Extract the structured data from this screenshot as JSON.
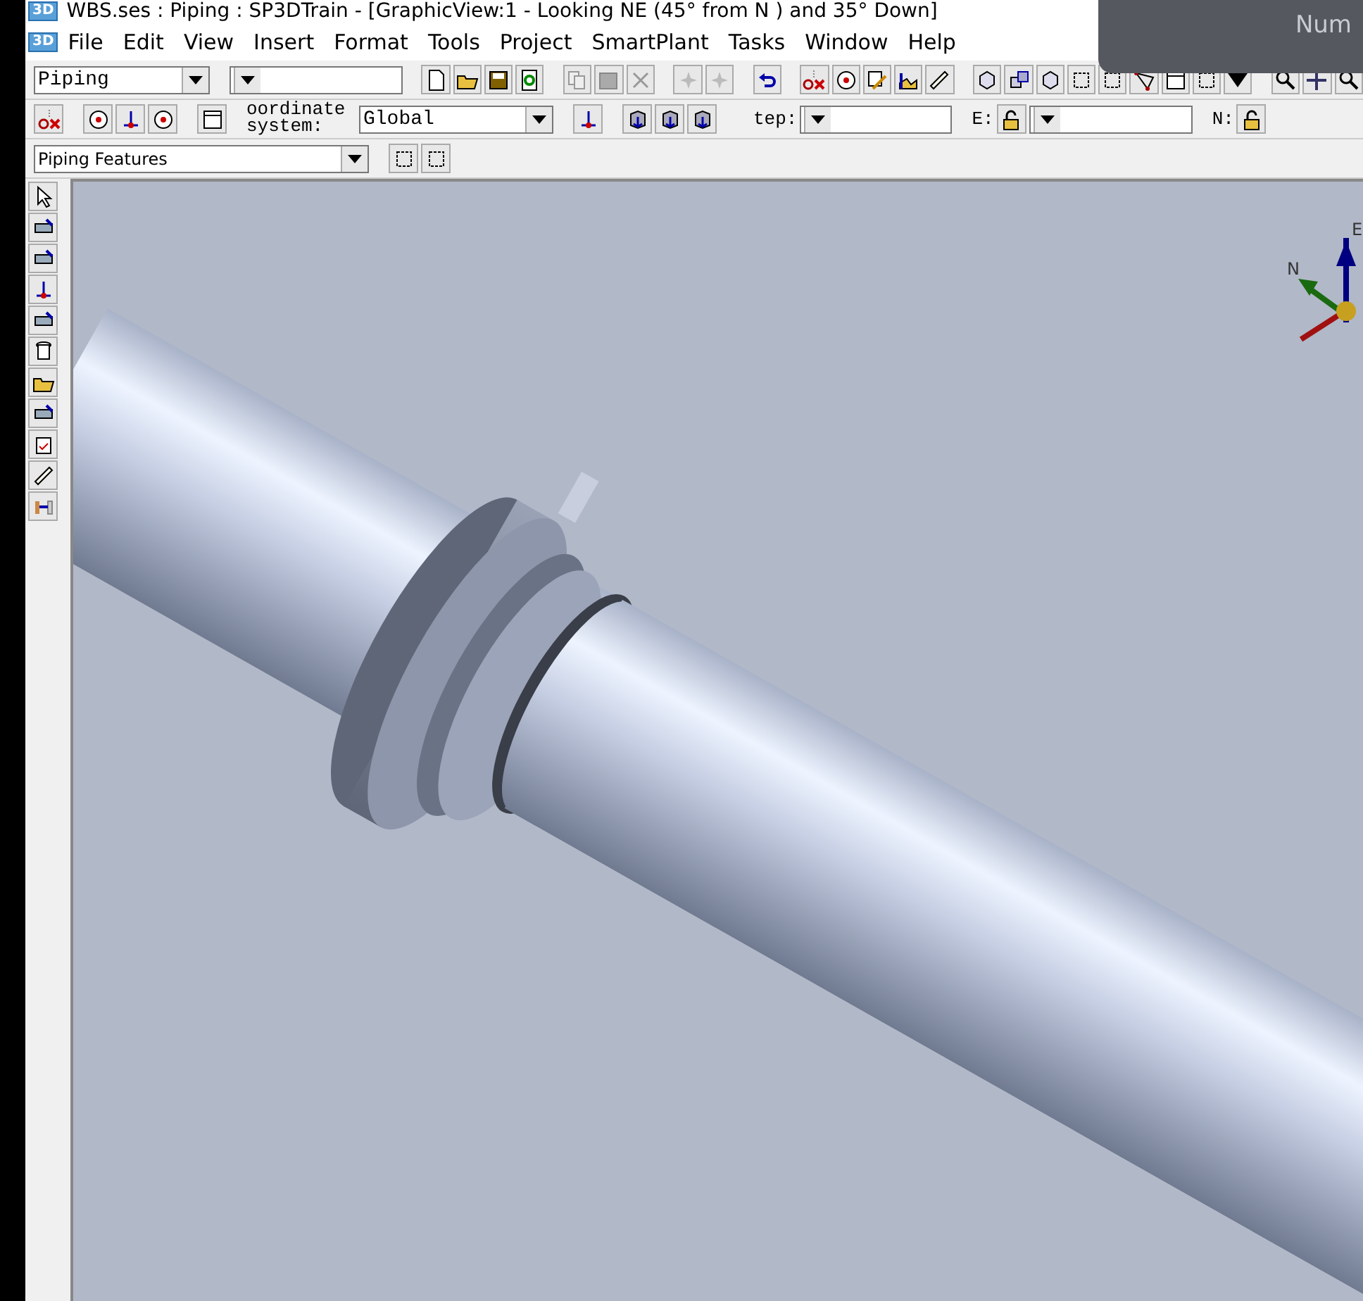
{
  "window": {
    "title": "WBS.ses : Piping : SP3DTrain - [GraphicView:1 - Looking NE (45° from N ) and 35° Down]",
    "app_badge": "3D"
  },
  "menu_bar": {
    "badge": "3D",
    "items": [
      "File",
      "Edit",
      "View",
      "Insert",
      "Format",
      "Tools",
      "Project",
      "SmartPlant",
      "Tasks",
      "Window",
      "Help"
    ]
  },
  "toolbar_main": {
    "task_combo": "Piping"
  },
  "toolbar_coordinates": {
    "coordinate_label": "oordinate system:",
    "coordinate_combo": "Global",
    "step_label": "tep:",
    "e_label": "E:",
    "n_label": "N:"
  },
  "toolbar_features": {
    "filter_combo": "Piping Features"
  },
  "view": {
    "compass": {
      "north_label": "N",
      "east_label": "E"
    }
  },
  "overlay": {
    "text": "Num"
  }
}
